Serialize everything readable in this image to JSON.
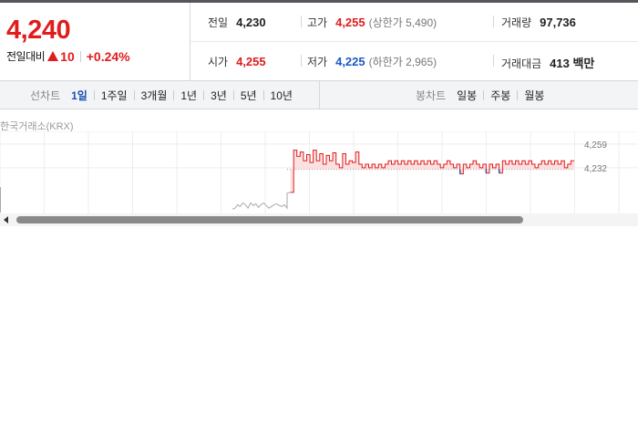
{
  "quote": {
    "price": "4,240",
    "change_label": "전일대비",
    "change_value": "10",
    "change_percent": "+0.24%",
    "prev_close_label": "전일",
    "prev_close": "4,230",
    "open_label": "시가",
    "open": "4,255",
    "high_label": "고가",
    "high": "4,255",
    "upper_limit": "(상한가 5,490)",
    "low_label": "저가",
    "low": "4,225",
    "lower_limit": "(하한가 2,965)",
    "volume_label": "거래량",
    "volume": "97,736",
    "value_label": "거래대금",
    "value": "413 백만"
  },
  "line_tabs": {
    "heading": "선차트",
    "items": [
      "1일",
      "1주일",
      "3개월",
      "1년",
      "3년",
      "5년",
      "10년"
    ],
    "active": "1일"
  },
  "candle_tabs": {
    "heading": "봉차트",
    "items": [
      "일봉",
      "주봉",
      "월봉"
    ]
  },
  "exchange": "한국거래소(KRX)",
  "chart_data": {
    "type": "line",
    "title": "",
    "xlabel": "",
    "ylabel": "",
    "y_ticks": [
      "4,259",
      "4,232"
    ],
    "ylim": [
      4180,
      4262
    ],
    "reference_value": 4230,
    "series": [
      {
        "values": [
          4230,
          4185,
          4186,
          4190,
          4188,
          4192,
          4190,
          4186,
          4192,
          4189,
          4191,
          4187,
          4190,
          4192,
          4189,
          4186,
          4188,
          4190,
          4191,
          4189,
          4188,
          4190,
          4186,
          4203,
          4204,
          4252,
          4245,
          4250,
          4240,
          4247,
          4238,
          4252,
          4240,
          4248,
          4236,
          4246,
          4240,
          4249,
          4236,
          4232,
          4248,
          4236,
          4240,
          4238,
          4250,
          4236,
          4232,
          4236,
          4232,
          4236,
          4232,
          4236,
          4232,
          4236,
          4240,
          4236,
          4240,
          4236,
          4240,
          4236,
          4240,
          4236,
          4240,
          4236,
          4240,
          4236,
          4240,
          4236,
          4240,
          4236,
          4232,
          4236,
          4240,
          4236,
          4232,
          4236,
          4225,
          4236,
          4232,
          4236,
          4240,
          4236,
          4232,
          4236,
          4226,
          4236,
          4232,
          4236,
          4226,
          4240,
          4236,
          4240,
          4236,
          4240,
          4236,
          4240,
          4236,
          4240,
          4236,
          4232,
          4236,
          4240,
          4236,
          4240,
          4236,
          4240,
          4236,
          4240,
          4232,
          4236,
          4240,
          4240
        ]
      }
    ]
  },
  "colors": {
    "up": "#e01c1c",
    "down": "#1a5bc4"
  },
  "icons": {
    "change_direction": "triangle-up-icon",
    "scroll_left": "arrow-left-icon"
  }
}
